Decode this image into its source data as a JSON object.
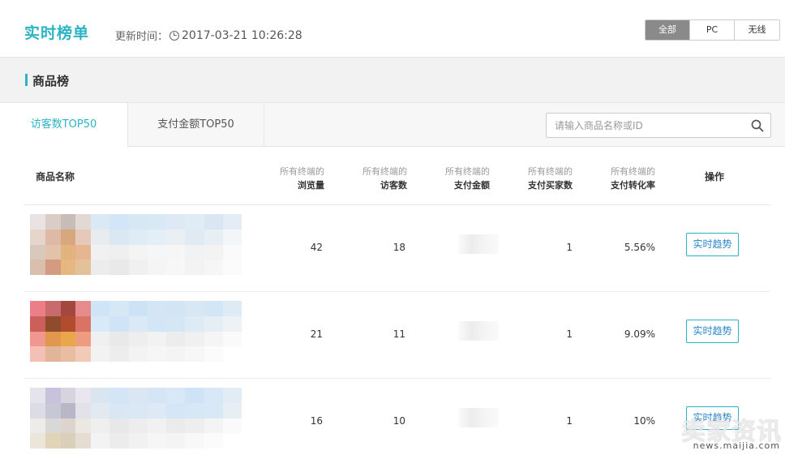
{
  "header": {
    "title": "实时榜单",
    "updated_label": "更新时间：",
    "updated_time": "2017-03-21 10:26:28",
    "filters": [
      {
        "label": "全部",
        "active": true
      },
      {
        "label": "PC",
        "active": false
      },
      {
        "label": "无线",
        "active": false
      }
    ]
  },
  "section": {
    "title": "商品榜"
  },
  "tabs": [
    {
      "label": "访客数TOP50",
      "active": true
    },
    {
      "label": "支付金额TOP50",
      "active": false
    }
  ],
  "search": {
    "placeholder": "请输入商品名称或ID"
  },
  "table": {
    "columns": {
      "name": "商品名称",
      "pv_sub": "所有终端的",
      "pv": "浏览量",
      "uv_sub": "所有终端的",
      "uv": "访客数",
      "pay_sub": "所有终端的",
      "pay": "支付金额",
      "buyers_sub": "所有终端的",
      "buyers": "支付买家数",
      "conv_sub": "所有终端的",
      "conv": "支付转化率",
      "op": "操作"
    },
    "rows": [
      {
        "pageviews": "42",
        "visitors": "18",
        "buyers": "1",
        "conversion": "5.56%",
        "action": "实时趋势",
        "thumb_colors": [
          "#e9e4e3",
          "#d9cdc6",
          "#c8bdb6",
          "#e3d9d4",
          "#e6d5cb",
          "#deb9a7",
          "#d9a77f",
          "#e7c9b9",
          "#d9c9bd",
          "#e2c2ab",
          "#e3b37e",
          "#e7b691",
          "#d8bfae",
          "#d39b7f",
          "#e7b681",
          "#e3c29b"
        ],
        "name_colors": [
          "#dbe9f5",
          "#d3e6f7",
          "#d7e8f5",
          "#d8e8f4",
          "#dde9f4",
          "#dfebf5",
          "#dae7f2",
          "#e4edf5",
          "#e8ecef",
          "#dae8f4",
          "#dfecf6",
          "#e3eef7",
          "#eaeff3",
          "#dfeaf2",
          "#e7eef4",
          "#f3f6f8",
          "#f1f1f1",
          "#efefef",
          "#f4f4f4",
          "#f5f6f7",
          "#f6f6f6",
          "#f1f2f3",
          "#f3f3f3",
          "#fafafa",
          "#ececec",
          "#e9e9e9",
          "#f0f0f0",
          "#f5f5f5",
          "#f7f7f7",
          "#f3f3f3",
          "#f6f6f6",
          "#fbfbfb"
        ]
      },
      {
        "pageviews": "21",
        "visitors": "11",
        "buyers": "1",
        "conversion": "9.09%",
        "action": "实时趋势",
        "thumb_colors": [
          "#ec7e89",
          "#c96b6d",
          "#a4483f",
          "#e68a8c",
          "#cc5f5a",
          "#8f4c2d",
          "#b24c2e",
          "#d97363",
          "#f0988f",
          "#e1974d",
          "#e9a64b",
          "#ee9c80",
          "#f4c0b6",
          "#e1b597",
          "#e9bda2",
          "#f3cab7"
        ],
        "name_colors": [
          "#cfe5f7",
          "#d6e8f6",
          "#cce3f6",
          "#d4e6f5",
          "#d2e5f5",
          "#d7e7f4",
          "#d3e6f6",
          "#dfebf4",
          "#d8e9f7",
          "#d0e4f7",
          "#dbe9f6",
          "#d3e6f7",
          "#d5e6f5",
          "#dcebf6",
          "#e5eef5",
          "#eef2f5",
          "#f0f0f0",
          "#e9e9e9",
          "#eeeeee",
          "#f2f2f2",
          "#ececec",
          "#f0f0f0",
          "#f5f5f5",
          "#fafafa",
          "#f2f2f2",
          "#ededed",
          "#f3f3f3",
          "#f6f6f6",
          "#f4f4f4",
          "#f7f7f7",
          "#fbfbfb",
          "#ffffff"
        ]
      },
      {
        "pageviews": "16",
        "visitors": "10",
        "buyers": "1",
        "conversion": "10%",
        "action": "实时趋势",
        "thumb_colors": [
          "#e5e4ec",
          "#c9c2dd",
          "#d7d4e0",
          "#e9e6ef",
          "#dcdce6",
          "#c8c7d6",
          "#b8b6c7",
          "#e3e2ea",
          "#eeece9",
          "#d8d8d8",
          "#dcd4cd",
          "#ebe7e1",
          "#ece5d9",
          "#e2d4b6",
          "#dacfb8",
          "#e6ddd2"
        ],
        "name_colors": [
          "#d9e6f2",
          "#d4e5f5",
          "#dae7f3",
          "#d4e5f6",
          "#d8e8f6",
          "#cfe3f6",
          "#d8e8f6",
          "#e1ecf5",
          "#e2e9f0",
          "#d9e7f4",
          "#dae8f5",
          "#dde9f5",
          "#d4e6f7",
          "#d6e7f6",
          "#d9e8f6",
          "#e7eef4",
          "#efefef",
          "#e8e8e8",
          "#ededed",
          "#f1f1f1",
          "#ebebeb",
          "#eeeeee",
          "#f4f4f4",
          "#fafafa",
          "#f3f3f3",
          "#ececec",
          "#f1f1f1",
          "#f6f6f6",
          "#f4f4f4",
          "#f8f8f8",
          "#fbfbfb",
          "#ffffff"
        ]
      }
    ]
  },
  "watermark": {
    "logo": "卖家资讯",
    "url": "news.maijia.com"
  },
  "colors": {
    "accent": "#2db4c4",
    "link": "#2a86c8",
    "active_filter": "#8a8a8a"
  }
}
